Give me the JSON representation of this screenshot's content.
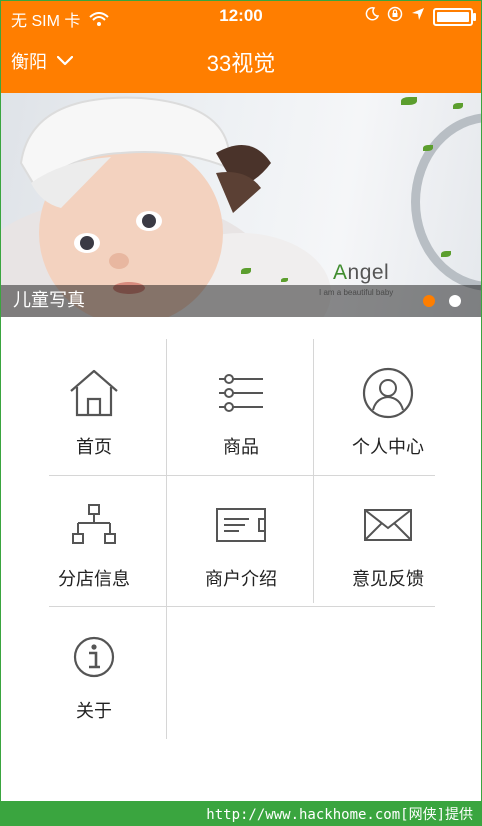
{
  "status_bar": {
    "carrier": "无 SIM 卡",
    "time": "12:00"
  },
  "header": {
    "city": "衡阳",
    "title": "33视觉"
  },
  "banner": {
    "brand_letter": "A",
    "brand_rest": "ngel",
    "tagline": "I am a beautiful baby",
    "caption": "儿童写真",
    "slide_count": 2,
    "active_slide": 1
  },
  "menu": {
    "items": [
      {
        "label": "首页",
        "icon": "home-icon"
      },
      {
        "label": "商品",
        "icon": "list-icon"
      },
      {
        "label": "个人中心",
        "icon": "user-icon"
      },
      {
        "label": "分店信息",
        "icon": "branch-icon"
      },
      {
        "label": "商户介绍",
        "icon": "card-icon"
      },
      {
        "label": "意见反馈",
        "icon": "mail-icon"
      },
      {
        "label": "关于",
        "icon": "info-icon"
      }
    ]
  },
  "footer": {
    "watermark": "http://www.hackhome.com[网侠]提供"
  },
  "colors": {
    "accent": "#ff7e00",
    "footer_green": "#3aa53f"
  }
}
